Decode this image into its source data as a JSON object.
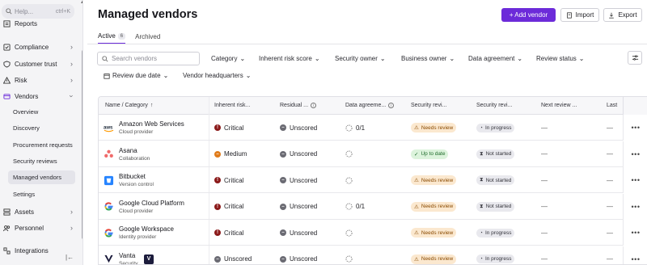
{
  "sidebar": {
    "search": {
      "placeholder": "Help...",
      "shortcut": "ctrl+K"
    },
    "items": [
      {
        "label": "Reports",
        "icon": "reports-icon"
      },
      {
        "label": "Compliance",
        "icon": "compliance-icon"
      },
      {
        "label": "Customer trust",
        "icon": "shield-icon"
      },
      {
        "label": "Risk",
        "icon": "warning-icon"
      },
      {
        "label": "Vendors",
        "icon": "vendors-icon"
      },
      {
        "label": "Assets",
        "icon": "assets-icon"
      },
      {
        "label": "Personnel",
        "icon": "people-icon"
      },
      {
        "label": "Integrations",
        "icon": "integrations-icon"
      }
    ],
    "vendor_sub": [
      "Overview",
      "Discovery",
      "Procurement requests",
      "Security reviews",
      "Managed vendors",
      "Settings"
    ]
  },
  "header": {
    "title": "Managed vendors",
    "add_vendor": "+ Add vendor",
    "import": "Import",
    "export": "Export"
  },
  "tabs": [
    {
      "label": "Active",
      "count": "6"
    },
    {
      "label": "Archived"
    }
  ],
  "filters": {
    "search_placeholder": "Search vendors",
    "items": [
      "Category",
      "Inherent risk score",
      "Security owner",
      "Business owner",
      "Data agreement",
      "Review status",
      "Review due date",
      "Vendor headquarters"
    ]
  },
  "table": {
    "columns": [
      "Name / Category",
      "Inherent risk...",
      "Residual ...",
      "Data agreeme...",
      "Security revi...",
      "Security revi...",
      "Next review ...",
      "Last"
    ],
    "rows": [
      {
        "name": "Amazon Web Services",
        "category": "Cloud provider",
        "logo": "aws-logo",
        "inherent": "Critical",
        "residual": "Unscored",
        "data": "0/1",
        "review": "Needs review",
        "review_status": "In progress",
        "next": "—",
        "last": "—"
      },
      {
        "name": "Asana",
        "category": "Collaboration",
        "logo": "asana-logo",
        "inherent": "Medium",
        "residual": "Unscored",
        "data": "",
        "review": "Up to date",
        "review_status": "Not started",
        "next": "—",
        "last": "—"
      },
      {
        "name": "Bitbucket",
        "category": "Version control",
        "logo": "bitbucket-logo",
        "inherent": "Critical",
        "residual": "Unscored",
        "data": "",
        "review": "Needs review",
        "review_status": "Not started",
        "next": "—",
        "last": "—"
      },
      {
        "name": "Google Cloud Platform",
        "category": "Cloud provider",
        "logo": "google-logo",
        "inherent": "Critical",
        "residual": "Unscored",
        "data": "0/1",
        "review": "Needs review",
        "review_status": "Not started",
        "next": "—",
        "last": "—"
      },
      {
        "name": "Google Workspace",
        "category": "Identity provider",
        "logo": "google-logo",
        "inherent": "Critical",
        "residual": "Unscored",
        "data": "",
        "review": "Needs review",
        "review_status": "In progress",
        "next": "—",
        "last": "—"
      },
      {
        "name": "Vanta",
        "category": "Security",
        "logo": "vanta-logo",
        "inherent": "Unscored",
        "residual": "Unscored",
        "data": "",
        "review": "Needs review",
        "review_status": "In progress",
        "next": "—",
        "last": "—"
      }
    ]
  },
  "colors": {
    "accent": "#6c2bd9",
    "critical": "#8b1a1a",
    "medium": "#e07b1a",
    "unscored": "#6b6b73"
  }
}
